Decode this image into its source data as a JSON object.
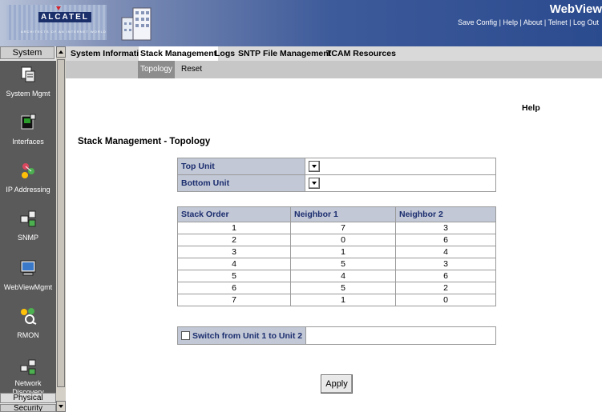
{
  "header": {
    "logo_text": "ALCATEL",
    "logo_subtext": "ARCHITECTS OF AN INTERNET WORLD",
    "title": "WebView",
    "links": [
      "Save Config",
      "Help",
      "About",
      "Telnet",
      "Log Out"
    ],
    "separator": " | "
  },
  "sidebar": {
    "top_label": "System",
    "items": [
      {
        "label": "System Mgmt",
        "icon": "system-mgmt-icon"
      },
      {
        "label": "Interfaces",
        "icon": "interfaces-icon"
      },
      {
        "label": "IP Addressing",
        "icon": "ip-addressing-icon"
      },
      {
        "label": "SNMP",
        "icon": "snmp-icon"
      },
      {
        "label": "WebViewMgmt",
        "icon": "webview-mgmt-icon"
      },
      {
        "label": "RMON",
        "icon": "rmon-icon"
      },
      {
        "label": "Network Discovery",
        "icon": "network-discovery-icon"
      }
    ],
    "physical_label": "Physical",
    "security_label": "Security"
  },
  "tabs": [
    "System Information",
    "Stack Management",
    "Logs",
    "SNTP",
    "File Management",
    "TCAM Resources"
  ],
  "active_tab": "Stack Management",
  "subtabs": [
    "Topology",
    "Reset"
  ],
  "active_subtab": "Topology",
  "help_label": "Help",
  "page_title": "Stack Management - Topology",
  "units": {
    "top_unit_label": "Top Unit",
    "bottom_unit_label": "Bottom Unit",
    "top_unit_value": "",
    "bottom_unit_value": ""
  },
  "stack_table": {
    "headers": [
      "Stack Order",
      "Neighbor 1",
      "Neighbor 2"
    ],
    "rows": [
      [
        "1",
        "7",
        "3"
      ],
      [
        "2",
        "0",
        "6"
      ],
      [
        "3",
        "1",
        "4"
      ],
      [
        "4",
        "5",
        "3"
      ],
      [
        "5",
        "4",
        "6"
      ],
      [
        "6",
        "5",
        "2"
      ],
      [
        "7",
        "1",
        "0"
      ]
    ]
  },
  "switch": {
    "label": "Switch from Unit 1 to Unit 2",
    "checked": false
  },
  "apply_label": "Apply",
  "colors": {
    "header_blue": "#2b4b8f",
    "label_cell_bg": "#c2c8d6",
    "label_text": "#1b2d6e",
    "sidebar_dark": "#5a5a5a"
  }
}
